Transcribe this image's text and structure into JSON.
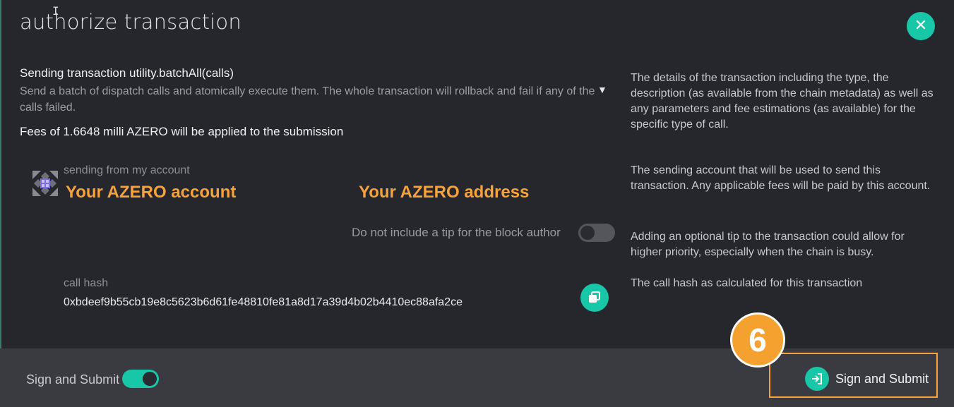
{
  "dialog": {
    "title": "authorize transaction",
    "close_icon": "close-icon"
  },
  "transaction": {
    "method": "Sending transaction utility.batchAll(calls)",
    "description": "Send a batch of dispatch calls and atomically execute them. The whole transaction will rollback and fail if any of the calls failed.",
    "fees": "Fees of 1.6648 milli AZERO will be applied to the submission",
    "help": "The details of the transaction including the type, the description (as available from the chain metadata) as well as any parameters and fee estimations (as available) for the specific type of call."
  },
  "account": {
    "label": "sending from my account",
    "name": "Your AZERO account",
    "address": "Your AZERO address",
    "help": "The sending account that will be used to send this transaction. Any applicable fees will be paid by this account."
  },
  "tip": {
    "label": "Do not include a tip for the block author",
    "enabled": false,
    "help": "Adding an optional tip to the transaction could allow for higher priority, especially when the chain is busy."
  },
  "call_hash": {
    "label": "call hash",
    "value": "0xbdeef9b55cb19e8c5623b6d61fe48810fe81a8d17a39d4b02b4410ec88afa2ce",
    "help": "The call hash as calculated for this transaction"
  },
  "footer": {
    "toggle_label": "Sign and Submit",
    "toggle_enabled": true,
    "submit_label": "Sign and Submit"
  },
  "annotation": {
    "step_number": "6"
  },
  "colors": {
    "accent": "#17c7a7",
    "highlight": "#f7a23a",
    "background": "#26272c",
    "footer": "#3a3b40"
  }
}
